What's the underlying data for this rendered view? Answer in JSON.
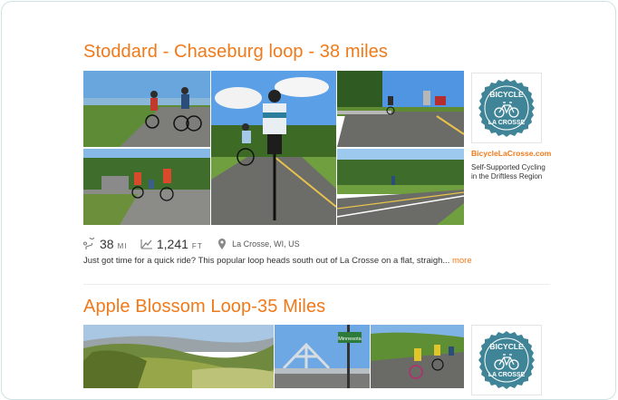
{
  "routes": [
    {
      "title": "Stoddard - Chaseburg loop - 38 miles",
      "distance_value": "38",
      "distance_unit": "MI",
      "elevation_value": "1,241",
      "elevation_unit": "FT",
      "location": "La Crosse, WI, US",
      "description": "Just got time for a quick ride? This popular loop heads south out of La Crosse on a flat, straigh...",
      "more_label": "more",
      "sponsor": {
        "logo_top": "BICYCLE",
        "logo_bottom": "LA CROSSE",
        "link": "BicycleLaCrosse.com",
        "tagline": "Self-Supported Cycling in the Driftless Region"
      }
    },
    {
      "title": "Apple Blossom Loop-35 Miles",
      "sign_text": "Minnesota",
      "sponsor": {
        "logo_top": "BICYCLE",
        "logo_bottom": "LA CROSSE"
      }
    }
  ],
  "colors": {
    "accent": "#f07a1a",
    "logo_teal": "#3f8597",
    "border": "#cde3e3"
  },
  "icons": {
    "distance": "route-pin-icon",
    "elevation": "elevation-icon",
    "location": "map-pin-icon"
  }
}
